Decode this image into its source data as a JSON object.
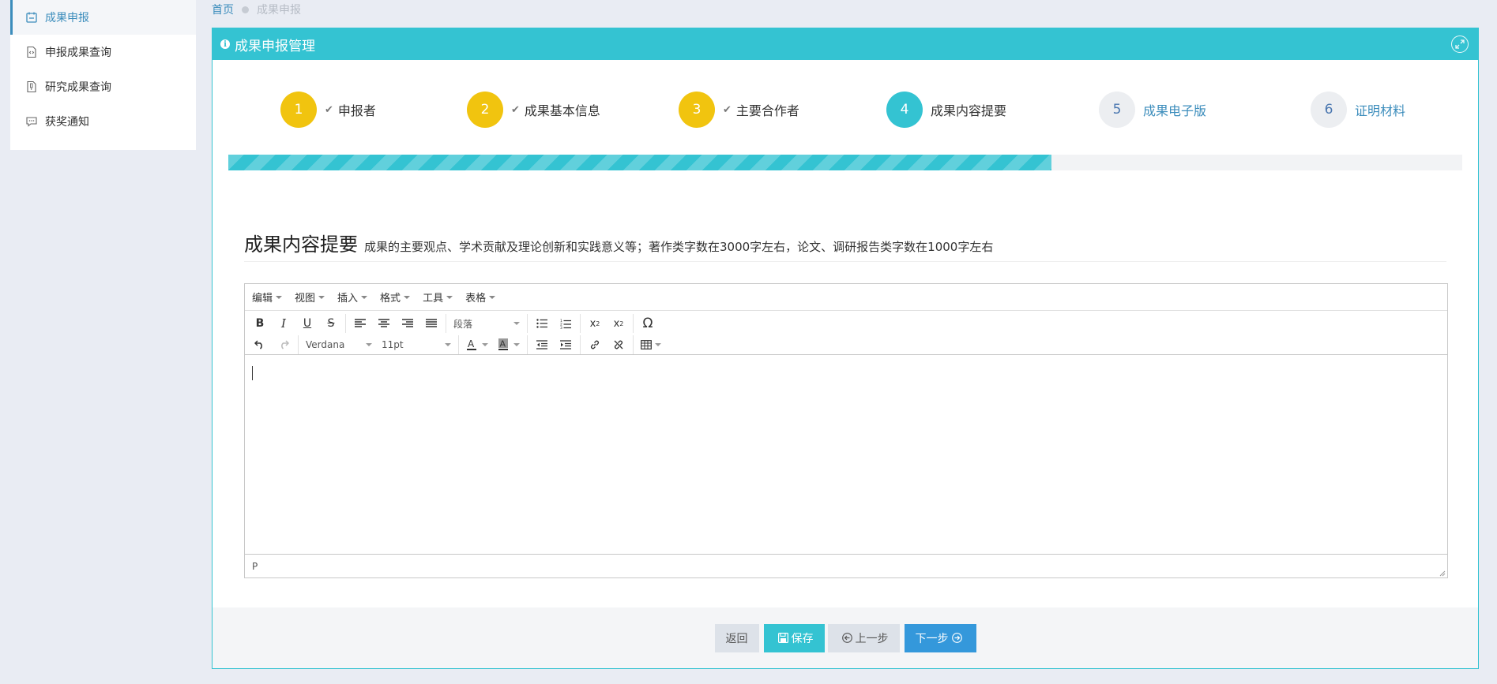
{
  "sidebar": {
    "items": [
      {
        "label": "成果申报",
        "icon": "calendar-icon",
        "active": true
      },
      {
        "label": "申报成果查询",
        "icon": "code-file-icon",
        "active": false
      },
      {
        "label": "研究成果查询",
        "icon": "document-file-icon",
        "active": false
      },
      {
        "label": "获奖通知",
        "icon": "chat-bubble-icon",
        "active": false
      }
    ]
  },
  "breadcrumb": {
    "home": "首页",
    "current": "成果申报"
  },
  "panel": {
    "title": "成果申报管理"
  },
  "steps": [
    {
      "num": "1",
      "label": "申报者",
      "state": "done"
    },
    {
      "num": "2",
      "label": "成果基本信息",
      "state": "done"
    },
    {
      "num": "3",
      "label": "主要合作者",
      "state": "done"
    },
    {
      "num": "4",
      "label": "成果内容提要",
      "state": "current"
    },
    {
      "num": "5",
      "label": "成果电子版",
      "state": "todo"
    },
    {
      "num": "6",
      "label": "证明材料",
      "state": "todo"
    }
  ],
  "progress": {
    "value": 0.667
  },
  "section": {
    "title": "成果内容提要",
    "description": "成果的主要观点、学术贡献及理论创新和实践意义等；著作类字数在3000字左右，论文、调研报告类字数在1000字左右"
  },
  "editor": {
    "menus": [
      "编辑",
      "视图",
      "插入",
      "格式",
      "工具",
      "表格"
    ],
    "block_format": "段落",
    "font_family": "Verdana",
    "font_size": "11pt",
    "status_path": "P",
    "content": ""
  },
  "footer": {
    "back": "返回",
    "save": "保存",
    "prev": "上一步",
    "next": "下一步"
  },
  "colors": {
    "accent": "#34c3d2",
    "done": "#f1c40f",
    "link": "#3c8dbc",
    "primary": "#3498db"
  }
}
